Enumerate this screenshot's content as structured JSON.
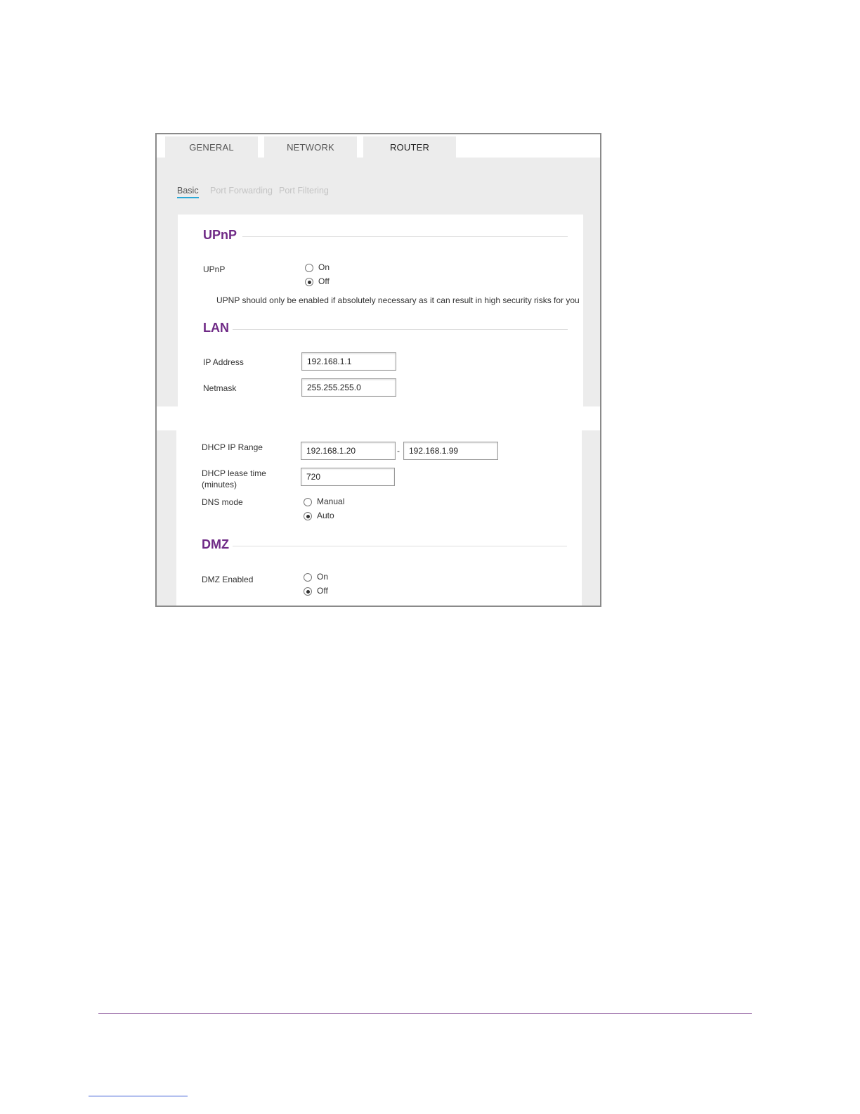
{
  "tabs": [
    "GENERAL",
    "NETWORK",
    "ROUTER"
  ],
  "subtabs": [
    "Basic",
    "Port Forwarding",
    "Port Filtering"
  ],
  "upnp": {
    "title": "UPnP",
    "label": "UPnP",
    "on_label": "On",
    "off_label": "Off",
    "selected": "Off",
    "note": "UPNP should only be enabled if absolutely necessary as it can result in high security risks for you"
  },
  "lan": {
    "title": "LAN",
    "ip_label": "IP Address",
    "ip_value": "192.168.1.1",
    "netmask_label": "Netmask",
    "netmask_value": "255.255.255.0",
    "dhcp_range_label": "DHCP IP Range",
    "dhcp_start": "192.168.1.20",
    "range_separator": "-",
    "dhcp_end": "192.168.1.99",
    "lease_label_line1": "DHCP lease time",
    "lease_label_line2": "(minutes)",
    "lease_value": "720",
    "dns_label": "DNS mode",
    "dns_manual": "Manual",
    "dns_auto": "Auto",
    "dns_selected": "Auto"
  },
  "dmz": {
    "title": "DMZ",
    "label": "DMZ Enabled",
    "on_label": "On",
    "off_label": "Off",
    "selected": "Off"
  },
  "colors": {
    "section_title": "#6f2a86",
    "active_underline": "#2aa7d6",
    "footer_rule": "#7b3f8e"
  }
}
